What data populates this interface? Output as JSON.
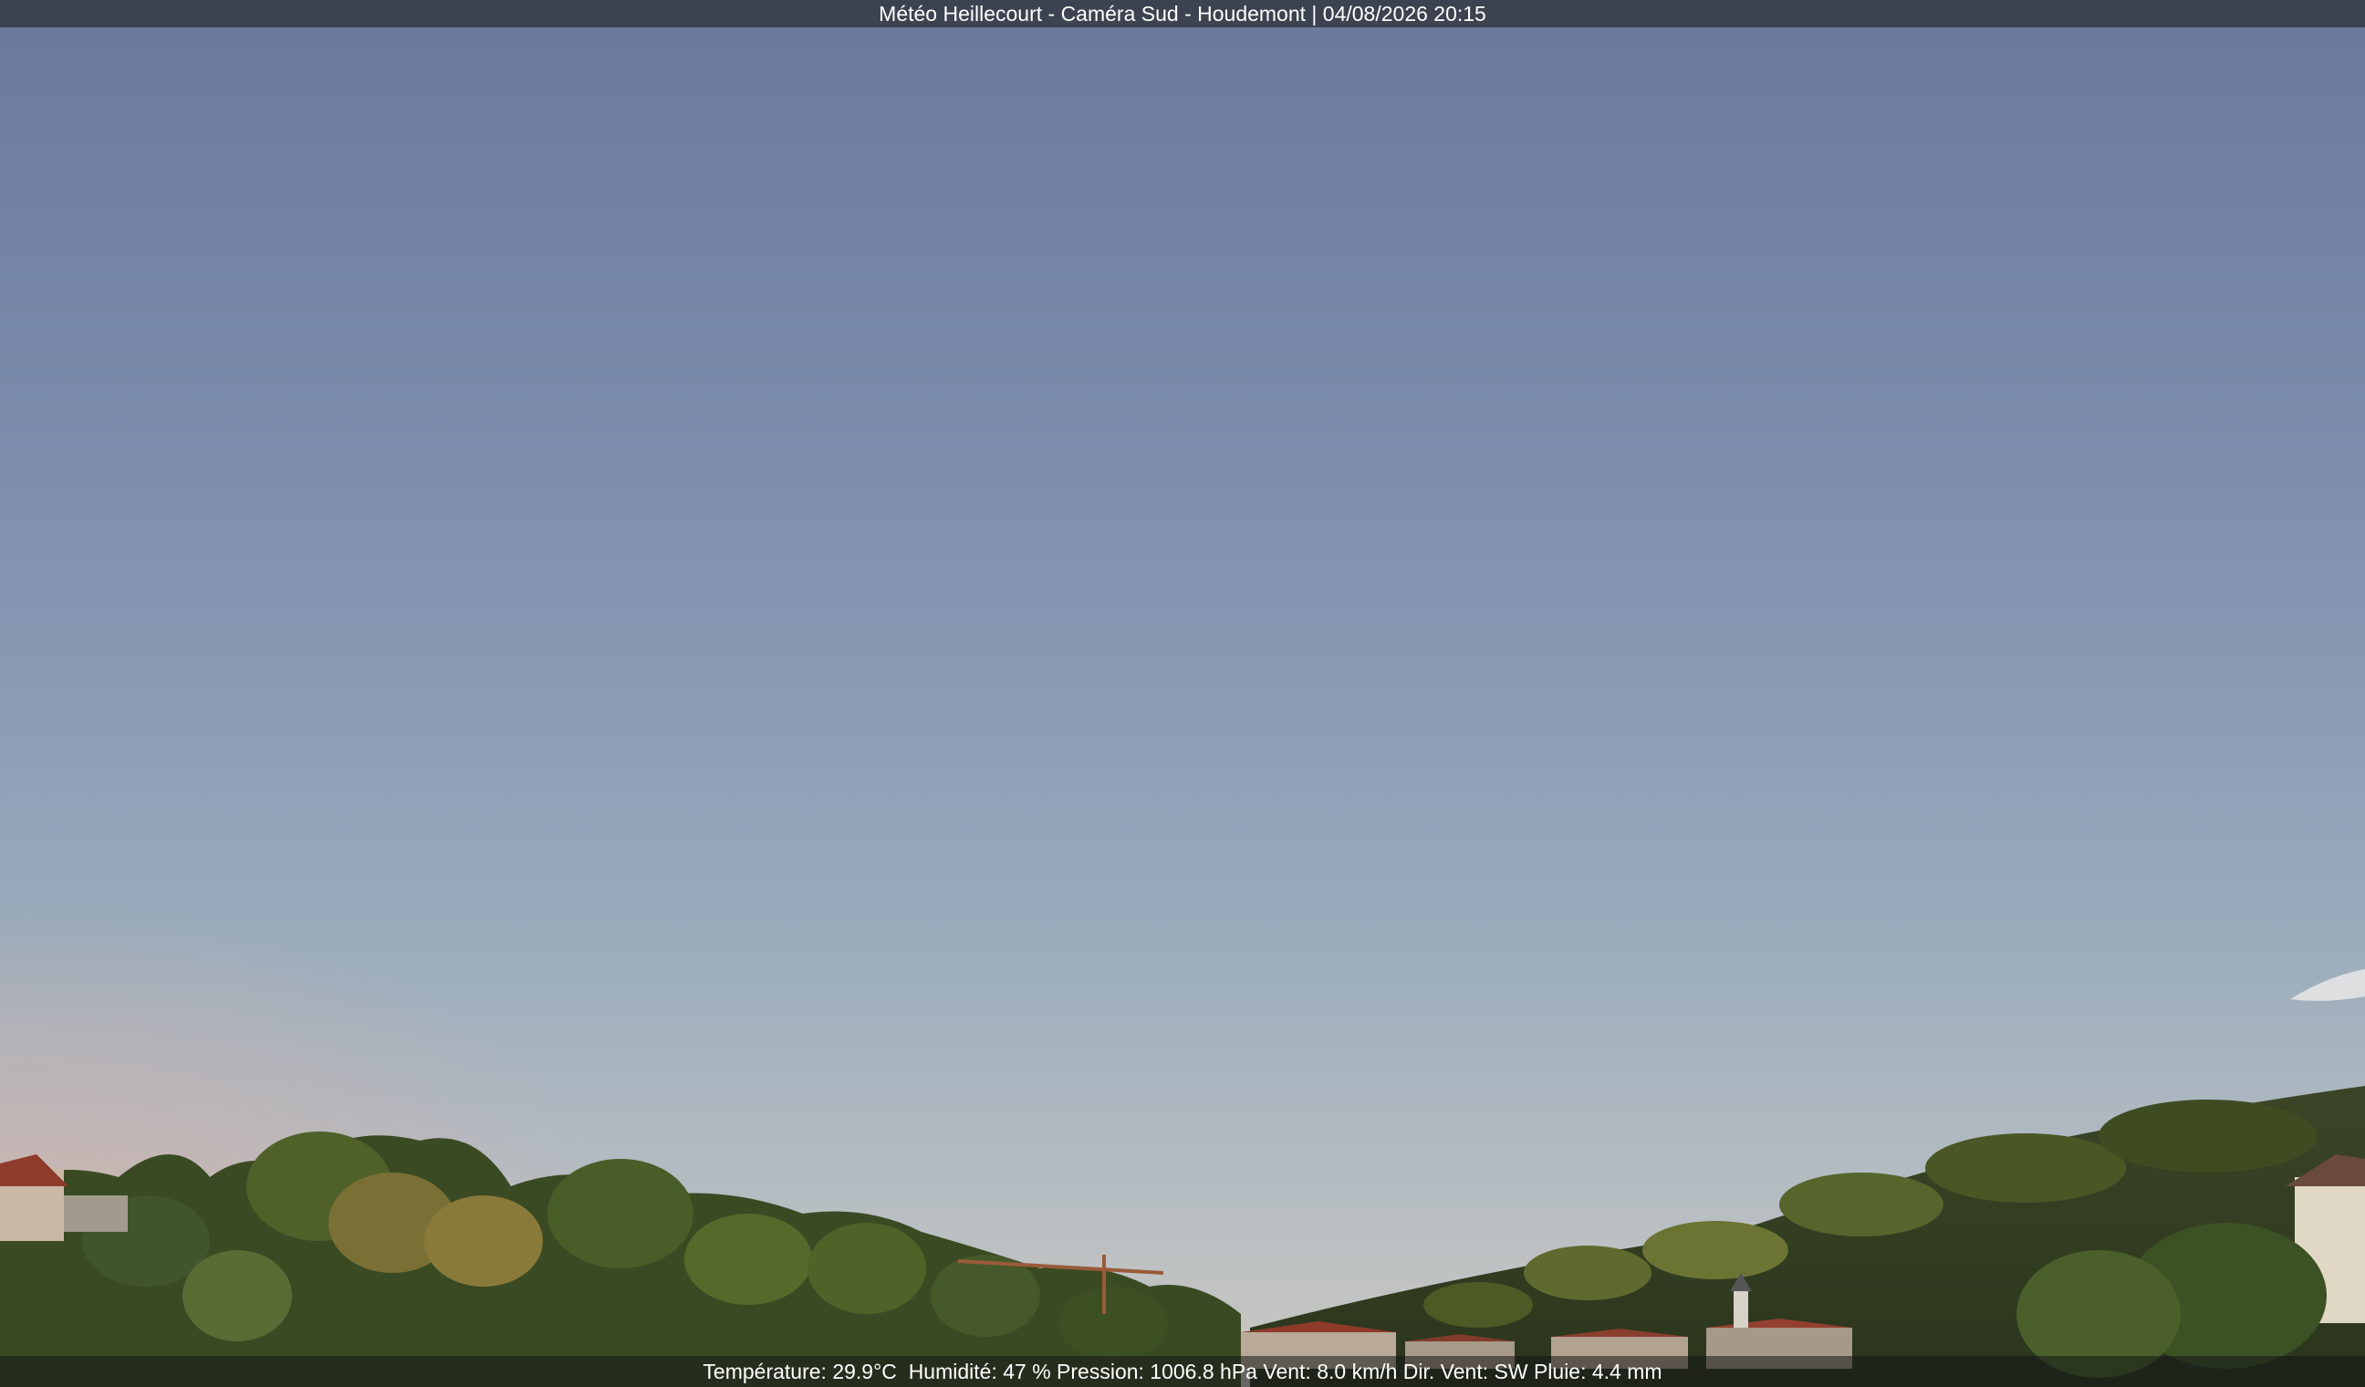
{
  "caption": {
    "title": "Météo Heillecourt - Caméra Sud - Houdemont | 04/08/2026 20:15"
  },
  "weather": {
    "temperature": "Température: 29.9°C",
    "humidity": "Humidité: 47 %",
    "pressure": "Pression: 1006.8 hPa",
    "wind": "Vent: 8.0 km/h",
    "wind_direction": "Dir. Vent: SW",
    "rain": "Pluie: 4.4 mm"
  },
  "colors": {
    "sky_top": "#6a7b9c",
    "sky_mid": "#8ea0b6",
    "sky_horizon": "#c9c8c2",
    "haze": "#d8b7ad",
    "foliage_dark": "#2f3f1e",
    "foliage_light": "#6d7a34",
    "roof": "#8e3b2c"
  }
}
